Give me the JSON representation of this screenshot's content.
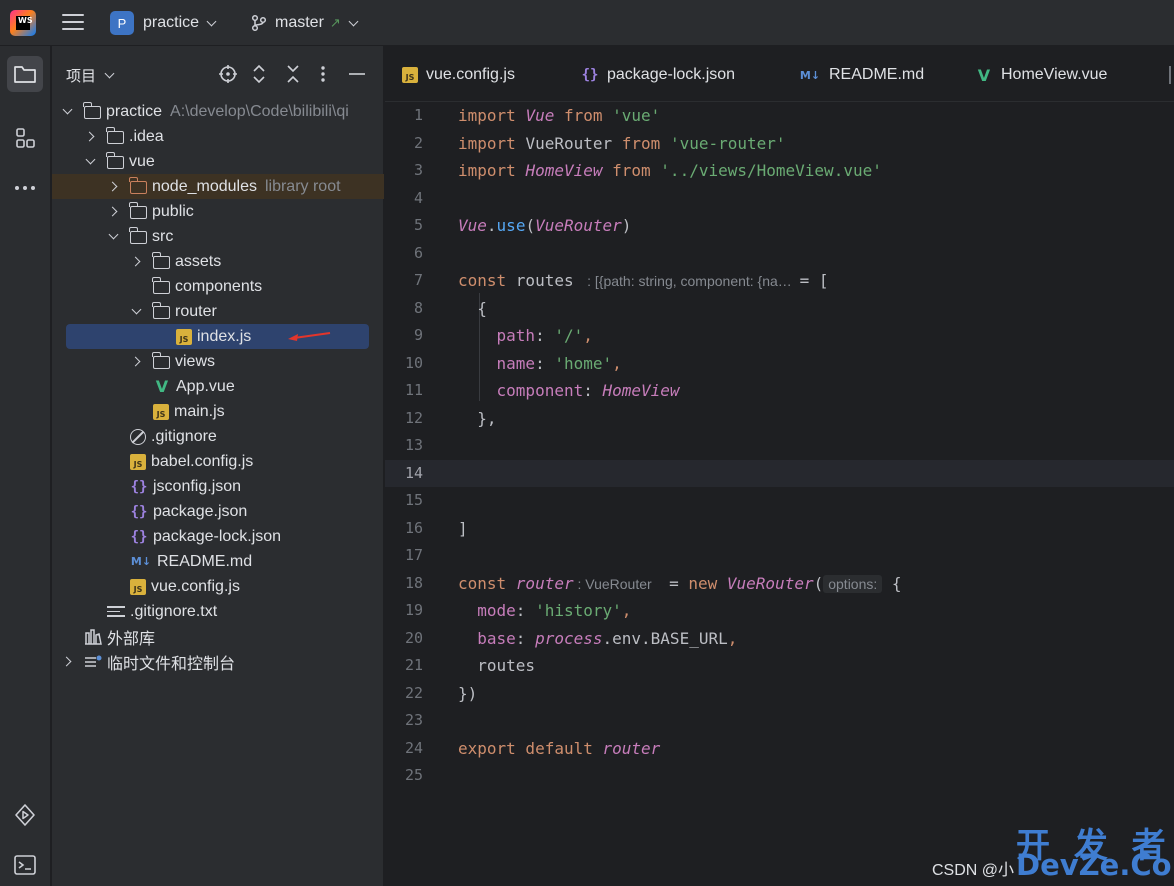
{
  "titlebar": {
    "project_badge": "P",
    "project_name": "practice",
    "branch": "master"
  },
  "project_panel": {
    "title": "项目",
    "tree": [
      {
        "label": "practice",
        "hint": "A:\\develop\\Code\\bilibili\\qi",
        "icon": "folder",
        "expand": "down",
        "depth": 0
      },
      {
        "label": ".idea",
        "icon": "folder",
        "expand": "right",
        "depth": 1
      },
      {
        "label": "vue",
        "icon": "folder",
        "expand": "down",
        "depth": 1
      },
      {
        "label": "node_modules",
        "hint": "library root",
        "icon": "folder-orange",
        "expand": "right",
        "depth": 2,
        "state": "libroot"
      },
      {
        "label": "public",
        "icon": "folder",
        "expand": "right",
        "depth": 2
      },
      {
        "label": "src",
        "icon": "folder",
        "expand": "down",
        "depth": 2
      },
      {
        "label": "assets",
        "icon": "folder",
        "expand": "right",
        "depth": 3
      },
      {
        "label": "components",
        "icon": "folder",
        "expand": "none",
        "depth": 3
      },
      {
        "label": "router",
        "icon": "folder",
        "expand": "down",
        "depth": 3
      },
      {
        "label": "index.js",
        "icon": "js",
        "expand": "none",
        "depth": 4,
        "state": "selected"
      },
      {
        "label": "views",
        "icon": "folder",
        "expand": "right",
        "depth": 3
      },
      {
        "label": "App.vue",
        "icon": "vue",
        "expand": "none",
        "depth": 3
      },
      {
        "label": "main.js",
        "icon": "js",
        "expand": "none",
        "depth": 3
      },
      {
        "label": ".gitignore",
        "icon": "ignore",
        "expand": "none",
        "depth": 2
      },
      {
        "label": "babel.config.js",
        "icon": "js",
        "expand": "none",
        "depth": 2
      },
      {
        "label": "jsconfig.json",
        "icon": "json",
        "expand": "none",
        "depth": 2
      },
      {
        "label": "package.json",
        "icon": "json",
        "expand": "none",
        "depth": 2
      },
      {
        "label": "package-lock.json",
        "icon": "json",
        "expand": "none",
        "depth": 2
      },
      {
        "label": "README.md",
        "icon": "md",
        "expand": "none",
        "depth": 2
      },
      {
        "label": "vue.config.js",
        "icon": "js",
        "expand": "none",
        "depth": 2
      },
      {
        "label": ".gitignore.txt",
        "icon": "txt",
        "expand": "none",
        "depth": 1
      },
      {
        "label": "外部库",
        "icon": "library",
        "expand": "none",
        "depth": 0
      },
      {
        "label": "临时文件和控制台",
        "icon": "scratch",
        "expand": "right",
        "depth": 0
      }
    ]
  },
  "tabs": [
    {
      "label": "vue.config.js",
      "icon": "js"
    },
    {
      "label": "package-lock.json",
      "icon": "json"
    },
    {
      "label": "README.md",
      "icon": "md"
    },
    {
      "label": "HomeView.vue",
      "icon": "vue"
    }
  ],
  "icon_glyphs": {
    "js": "JS",
    "json": "{}",
    "md": "M↓",
    "vue": "V"
  },
  "editor": {
    "current_line": 14,
    "line_numbers": [
      "1",
      "2",
      "3",
      "4",
      "5",
      "6",
      "7",
      "8",
      "9",
      "10",
      "11",
      "12",
      "13",
      "14",
      "15",
      "16",
      "17",
      "18",
      "19",
      "20",
      "21",
      "22",
      "23",
      "24",
      "25"
    ],
    "lines": [
      [
        [
          "kw",
          "import "
        ],
        [
          "cls",
          "Vue"
        ],
        [
          "kw",
          " from "
        ],
        [
          "str",
          "'vue'"
        ]
      ],
      [
        [
          "kw",
          "import "
        ],
        [
          "id",
          "VueRouter"
        ],
        [
          "kw",
          " from "
        ],
        [
          "str",
          "'vue-router'"
        ]
      ],
      [
        [
          "kw",
          "import "
        ],
        [
          "cls",
          "HomeView"
        ],
        [
          "kw",
          " from "
        ],
        [
          "str",
          "'../views/HomeView.vue'"
        ]
      ],
      [],
      [
        [
          "cls",
          "Vue"
        ],
        [
          "id",
          "."
        ],
        [
          "fn",
          "use"
        ],
        [
          "id",
          "("
        ],
        [
          "cls",
          "VueRouter"
        ],
        [
          "id",
          ")"
        ]
      ],
      [],
      [
        [
          "kw",
          "const "
        ],
        [
          "id",
          "routes "
        ],
        [
          "inlay",
          " : [{path: string, component: {na…  "
        ],
        [
          "id",
          "= ["
        ]
      ],
      [
        [
          "id",
          "  {"
        ]
      ],
      [
        [
          "id",
          "    "
        ],
        [
          "prop",
          "path"
        ],
        [
          "id",
          ": "
        ],
        [
          "str",
          "'/'"
        ],
        [
          "kw",
          ","
        ]
      ],
      [
        [
          "id",
          "    "
        ],
        [
          "prop",
          "name"
        ],
        [
          "id",
          ": "
        ],
        [
          "str",
          "'home'"
        ],
        [
          "kw",
          ","
        ]
      ],
      [
        [
          "id",
          "    "
        ],
        [
          "prop",
          "component"
        ],
        [
          "id",
          ": "
        ],
        [
          "cls",
          "HomeView"
        ]
      ],
      [
        [
          "id",
          "  },"
        ]
      ],
      [],
      [],
      [],
      [
        [
          "id",
          "]"
        ]
      ],
      [],
      [
        [
          "kw",
          "const "
        ],
        [
          "cls",
          "router"
        ],
        [
          "inlay",
          " : VueRouter  "
        ],
        [
          "id",
          " = "
        ],
        [
          "kw",
          "new "
        ],
        [
          "cls",
          "VueRouter"
        ],
        [
          "id",
          "("
        ],
        [
          "inlaybox",
          "options:"
        ],
        [
          "id",
          " {"
        ]
      ],
      [
        [
          "id",
          "  "
        ],
        [
          "prop",
          "mode"
        ],
        [
          "id",
          ": "
        ],
        [
          "str",
          "'history'"
        ],
        [
          "kw",
          ","
        ]
      ],
      [
        [
          "id",
          "  "
        ],
        [
          "prop",
          "base"
        ],
        [
          "id",
          ": "
        ],
        [
          "cls",
          "process"
        ],
        [
          "id",
          ".env.BASE_URL"
        ],
        [
          "kw",
          ","
        ]
      ],
      [
        [
          "id",
          "  routes"
        ]
      ],
      [
        [
          "id",
          "})"
        ]
      ],
      [],
      [
        [
          "kw",
          "export default "
        ],
        [
          "cls",
          "router"
        ]
      ],
      []
    ]
  },
  "watermark": {
    "csdn": "CSDN @小",
    "brand_cn": "开 发 者",
    "brand_en": "DevZe.CoM"
  }
}
